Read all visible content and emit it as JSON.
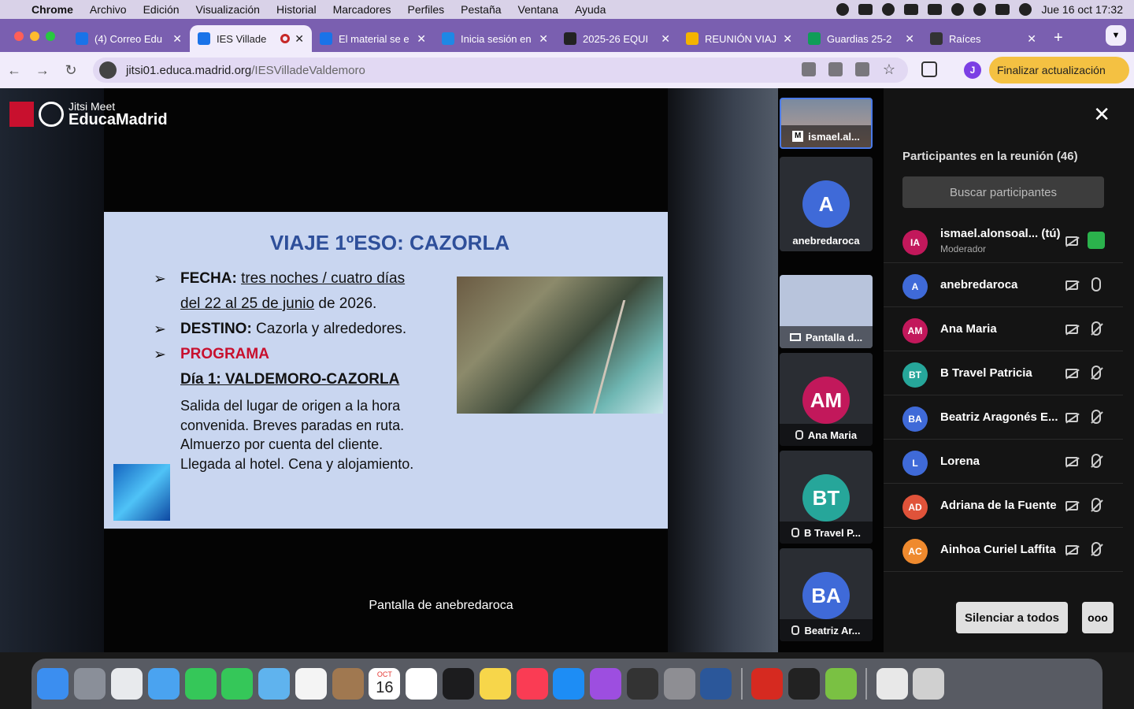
{
  "menubar": {
    "app": "Chrome",
    "items": [
      "Archivo",
      "Edición",
      "Visualización",
      "Historial",
      "Marcadores",
      "Perfiles",
      "Pestaña",
      "Ventana",
      "Ayuda"
    ],
    "datetime": "Jue 16 oct 17:32"
  },
  "tabs": [
    {
      "title": "(4) Correo Edu",
      "color": "#1a73e8"
    },
    {
      "title": "IES Villade",
      "color": "#1a73e8",
      "active": true
    },
    {
      "title": "El material se e",
      "color": "#1a73e8"
    },
    {
      "title": "Inicia sesión en",
      "color": "#1e88e5"
    },
    {
      "title": "2025-26 EQUI",
      "color": "#222222"
    },
    {
      "title": "REUNIÓN VIAJ",
      "color": "#f4b400"
    },
    {
      "title": "Guardias 25-2",
      "color": "#0f9d58"
    },
    {
      "title": "Raíces",
      "color": "#333333"
    }
  ],
  "address": {
    "domain": "jitsi01.educa.madrid.org",
    "path": "/IESVilladeValdemoro"
  },
  "profile_initial": "J",
  "update_button": "Finalizar actualización",
  "logo": {
    "line1": "Jitsi Meet",
    "line2": "EducaMadrid"
  },
  "slide": {
    "title": "VIAJE 1ºESO: CAZORLA",
    "fecha_label": "FECHA:",
    "fecha_value1": "tres noches / cuatro días",
    "fecha_value2a": "del 22 al 25 de junio",
    "fecha_value2b": " de 2026.",
    "destino_label": "DESTINO:",
    "destino_value": " Cazorla y alrededores.",
    "programa": "PROGRAMA",
    "dia1": "Día 1: VALDEMORO-CAZORLA",
    "body": [
      "Salida del lugar de origen a la hora",
      "convenida. Breves paradas en ruta.",
      "Almuerzo por cuenta del cliente.",
      "Llegada al hotel. Cena y alojamiento."
    ],
    "bullet": "➢"
  },
  "screen_label": "Pantalla de anebredaroca",
  "filmstrip": [
    {
      "name": "ismael.al...",
      "type": "video"
    },
    {
      "name": "anebredaroca",
      "initials": "A",
      "color": "#3f6ad8"
    },
    {
      "name": "Pantalla d...",
      "type": "screen"
    },
    {
      "name": "Ana Maria",
      "initials": "AM",
      "color": "#c2185b",
      "muted": true
    },
    {
      "name": "B Travel P...",
      "initials": "BT",
      "color": "#26a69a",
      "muted": true
    },
    {
      "name": "Beatriz Ar...",
      "initials": "BA",
      "color": "#3f6ad8",
      "muted": true
    }
  ],
  "participants": {
    "title": "Participantes en la reunión (46)",
    "search_placeholder": "Buscar participantes",
    "list": [
      {
        "initials": "IA",
        "name": "ismael.alonsoal... (tú)",
        "role": "Moderador",
        "color": "#c2185b",
        "mic": "on"
      },
      {
        "initials": "A",
        "name": "anebredaroca",
        "color": "#3f6ad8",
        "mic": "live"
      },
      {
        "initials": "AM",
        "name": "Ana Maria",
        "color": "#c2185b",
        "mic": "off"
      },
      {
        "initials": "BT",
        "name": "B Travel Patricia",
        "color": "#26a69a",
        "mic": "off"
      },
      {
        "initials": "BA",
        "name": "Beatriz Aragonés E...",
        "color": "#3f6ad8",
        "mic": "off"
      },
      {
        "initials": "L",
        "name": "Lorena",
        "color": "#3f6ad8",
        "mic": "off"
      },
      {
        "initials": "AD",
        "name": "Adriana de la Fuente",
        "color": "#e0533a",
        "mic": "off"
      },
      {
        "initials": "AC",
        "name": "Ainhoa Curiel Laffita",
        "color": "#ef8a2e",
        "mic": "off"
      }
    ],
    "mute_all": "Silenciar a todos",
    "more": "ooo"
  },
  "dock": {
    "calendar_month": "OCT",
    "calendar_day": "16",
    "apps": [
      "finder-icon",
      "launchpad-icon",
      "chrome-icon",
      "mail-icon",
      "facetime-icon",
      "messages-icon",
      "maps-icon",
      "photos-icon",
      "contacts-icon",
      "calendar-icon",
      "reminders-icon",
      "appletv-icon",
      "notes-icon",
      "music-icon",
      "appstore-icon",
      "podcasts-icon",
      "scrivener-icon",
      "settings-icon",
      "word-icon",
      "acrobat-icon",
      "terminal-icon",
      "add-icon",
      "file-icon",
      "trash-icon"
    ]
  }
}
